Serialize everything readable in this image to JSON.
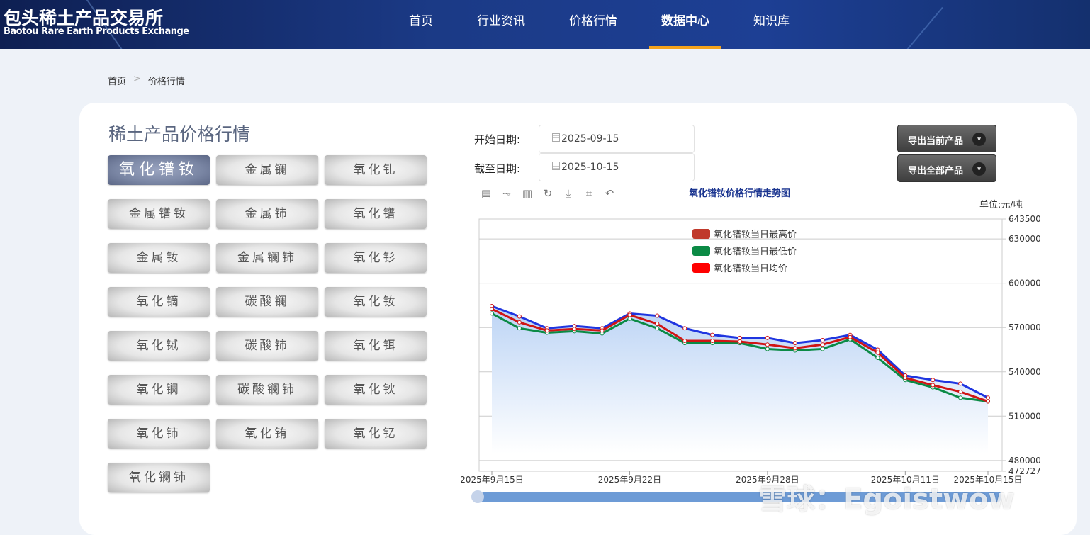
{
  "header": {
    "logo_cn": "包头稀土产品交易所",
    "logo_en": "Baotou Rare Earth Products Exchange",
    "nav": [
      {
        "label": "首页"
      },
      {
        "label": "行业资讯"
      },
      {
        "label": "价格行情"
      },
      {
        "label": "数据中心"
      },
      {
        "label": "知识库"
      }
    ],
    "active_nav": "数据中心"
  },
  "breadcrumb": {
    "home": "首页",
    "sep": ">",
    "current": "价格行情"
  },
  "panel": {
    "title": "稀土产品价格行情",
    "active_product": "氧化镨钕",
    "products": [
      "氧化镨钕",
      "金属镧",
      "氧化钆",
      "金属镨钕",
      "金属铈",
      "氧化镨",
      "金属钕",
      "金属镧铈",
      "氧化钐",
      "氧化镝",
      "碳酸镧",
      "氧化钕",
      "氧化铽",
      "碳酸铈",
      "氧化铒",
      "氧化镧",
      "碳酸镧铈",
      "氧化钬",
      "氧化铈",
      "氧化铕",
      "氧化钇",
      "氧化镧铈"
    ]
  },
  "filters": {
    "start_label": "开始日期:",
    "start_value": "2025-09-15",
    "end_label": "截至日期:",
    "end_value": "2025-10-15",
    "export_current": "导出当前产品",
    "export_all": "导出全部产品",
    "chev": "v"
  },
  "toolbar": [
    "data-view-icon",
    "line-icon",
    "bar-icon",
    "refresh-icon",
    "download-icon",
    "zoom-icon",
    "zoom-reset-icon"
  ],
  "colors": {
    "high": "#1f35e0",
    "low": "#0b8a45",
    "avg": "#d01515",
    "area": "#c9dcf7"
  },
  "watermark": "雪球：Egoistwow",
  "chart_data": {
    "type": "line",
    "title": "氧化镨钕价格行情走势图",
    "unit": "单位:元/吨",
    "ylim": [
      472727,
      643500
    ],
    "yticks": [
      "643500",
      "630000",
      "600000",
      "570000",
      "540000",
      "510000",
      "480000",
      "472727"
    ],
    "ytick_values": [
      643500,
      630000,
      600000,
      570000,
      540000,
      510000,
      480000,
      472727
    ],
    "x": [
      "2025-09-15",
      "2025-09-16",
      "2025-09-17",
      "2025-09-18",
      "2025-09-19",
      "2025-09-22",
      "2025-09-23",
      "2025-09-24",
      "2025-09-25",
      "2025-09-26",
      "2025-09-28",
      "2025-09-29",
      "2025-09-30",
      "2025-10-09",
      "2025-10-10",
      "2025-10-11",
      "2025-10-13",
      "2025-10-14",
      "2025-10-15"
    ],
    "xtick_labels": [
      {
        "i": 0,
        "label": "2025年9月15日"
      },
      {
        "i": 5,
        "label": "2025年9月22日"
      },
      {
        "i": 10,
        "label": "2025年9月28日"
      },
      {
        "i": 15,
        "label": "2025年10月11日"
      },
      {
        "i": 18,
        "label": "2025年10月15日"
      }
    ],
    "series": [
      {
        "name": "氧化镨钕当日最高价",
        "legend_color": "#c0392b",
        "values": [
          584500,
          577500,
          569500,
          571000,
          569500,
          579500,
          578000,
          569500,
          565000,
          563000,
          563000,
          559500,
          561500,
          565000,
          555000,
          537500,
          534500,
          532000,
          522500
        ]
      },
      {
        "name": "氧化镨钕当日最低价",
        "legend_color": "#0b8a45",
        "values": [
          579500,
          569500,
          566500,
          567500,
          566000,
          576000,
          569500,
          559500,
          559500,
          559500,
          555500,
          554500,
          555500,
          562000,
          549500,
          534500,
          529500,
          522500,
          520000
        ]
      },
      {
        "name": "氧化镨钕当日均价",
        "legend_color": "#ff0000",
        "values": [
          582500,
          573500,
          568000,
          569000,
          568000,
          578500,
          572500,
          561000,
          561000,
          560500,
          558500,
          556000,
          558500,
          563500,
          553000,
          536000,
          531000,
          526500,
          520000
        ]
      }
    ]
  }
}
